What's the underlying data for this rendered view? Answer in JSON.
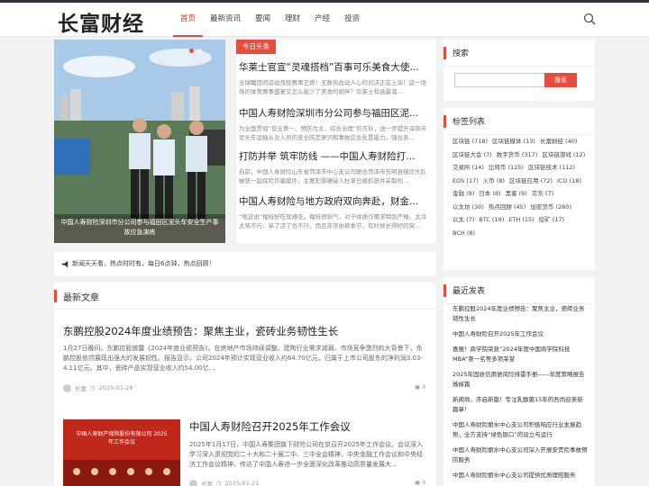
{
  "site": {
    "logo": "长富财经"
  },
  "nav": [
    "首页",
    "最新资讯",
    "要闻",
    "理财",
    "产经",
    "投资"
  ],
  "slider": {
    "caption": "中国人寿财险深圳市分公司参与福田区泥头车安全生产事故应急演练"
  },
  "headlines": {
    "tag": "今日头条",
    "items": [
      {
        "title": "华莱士官宣“灵魂搭档”百事可乐美食大使…",
        "desc": "全球瞩目的运动竞技赛事正燃！无数热血动人心的对决正在上演！这一场场的体育赛事盛宴又怎么能少了美食的相伴？华莱士和选最溜…"
      },
      {
        "title": "中国人寿财险深圳市分公司参与福田区泥…",
        "desc": "为全面贯彻“安全第一、预防为主、综合治理”的方针，进一步提升深圳市泥头车运输从业人员的安全防范意识和事故应急处置能力，强化各…"
      },
      {
        "title": "打防并举 筑牢防线 ——中国人寿财险打…",
        "desc": "自前，中国人寿财险山东省菏泽市中心支公司联合菏泽市东明县稽侦大队破获一起保险诈骗案件，主要犯罪嫌疑人杜某已被抓获并采取刑…"
      },
      {
        "title": "中国人寿财险与地方政府双向奔赴，财金…",
        "desc": "“啦这说”榴梿好吃就难吃，榴梿很损气，对于体质作要求特别严格，太冷太热不行，旱了涝了也不行，而且非常依赖季节，有时候长得好的突…"
      }
    ]
  },
  "notice": {
    "text": "新闻天天看，热点时时有，每日6点钟，热点回顾！"
  },
  "latest": {
    "heading": "最新文章",
    "articles": [
      {
        "title": "东鹏控股2024年度业绩预告：聚焦主业，瓷砖业务韧性生长",
        "desc": "1月27日晚间，东鹏控股披露《2024年度业绩预告》。在房地产市场持续调整、建陶行业需求减弱、市场竞争激烈的大背景下，东鹏控股依然展现出强大的发展韧性。报告显示，公司2024年预计实现营业收入约64.70亿元，归属于上市公司股东的净利润3.03-4.11亿元。其中，瓷砖产品实现营业收入约54.00亿…",
        "author": "长富",
        "date": "2025-01-28",
        "comments": "0"
      },
      {
        "title": "中国人寿财险召开2025年工作会议",
        "desc": "2025年1月17日，中国人寿集团旗下财险公司在京召开2025年工作会议。会议深入学习深入贯彻党的二十大和二十届二中、三中全会精神，中央金融工作会议和中央经济工作会议精神，传达了中国人寿进一步全面深化改革推动高质量发展大…",
        "author": "长富",
        "date": "2025-01-21",
        "comments": "0",
        "image_text": "中国人寿财产保险股份有限公司 2025年工作会议"
      }
    ]
  },
  "sidebar": {
    "search_heading": "搜索",
    "search_button": "搜索",
    "search_placeholder": "",
    "tags_heading": "标签列表",
    "tags": [
      "区块链 (718)",
      "区块链媒体 (13)",
      "长富财经 (40)",
      "区块链大会 (7)",
      "数字货币 (317)",
      "区块链游戏 (12)",
      "交易所 (14)",
      "比特币 (125)",
      "区块链技术 (112)",
      "EOS (17)",
      "火币 (8)",
      "区块链应用 (72)",
      "ICO (18)",
      "金融 (9)",
      "日本 (8)",
      "黑客 (9)",
      "京东 (7)",
      "以太坊 (30)",
      "热点回顾 (45)",
      "加密货币 (280)",
      "以太 (7)",
      "BTC (19)",
      "ETH (15)",
      "挖矿 (17)",
      "BCH (8)"
    ],
    "recent_heading": "最近发表",
    "recent": [
      "东鹏控股2024年度业绩预告：聚焦主业，瓷砖业务韧性生长",
      "中国人寿财险召开2025年工作会议",
      "喜报！商学院荣获“2024年度中国商学院科技MBA”第一名等多项荣誉",
      "2025年固收信用债风险排雷手册——年度策略报告姊妹篇",
      "新闻尚，序启新篇！专注乳酸菌15年的吾尚迎来新篇章！",
      "中国人寿财险丽水中心支公司积极响应行业发展趋势，全方支持“绿色银口”的设立与运行",
      "中国人寿财险丽水中心支公司深入开展安责险事故预防服务",
      "中国人寿财险丽水中心支公司提供优质理赔服务"
    ]
  },
  "colors": {
    "accent": "#e74c3c",
    "dark": "#2f3338"
  }
}
